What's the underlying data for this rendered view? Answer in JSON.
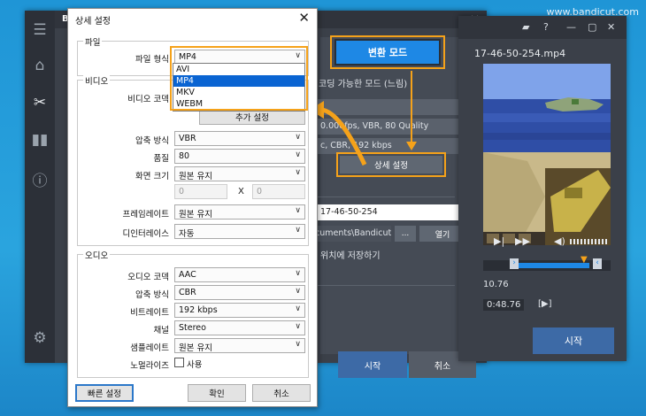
{
  "watermark": "www.bandicut.com",
  "colors": {
    "accent": "#1e88e5",
    "highlight": "#f5a21a",
    "selection": "#0a64d2"
  },
  "app": {
    "title_fragment": "B",
    "sidebar_icons": [
      "menu-icon",
      "home-icon",
      "cut-icon",
      "merge-icon",
      "info-icon",
      "settings-icon"
    ],
    "convert_mode": "변환 모드",
    "encoding_mode": "코딩 가능한 모드 (느림)",
    "video_info": "0.000fps, VBR, 80 Quality",
    "audio_info": "c, CBR, 192 kbps",
    "detail_settings": "상세 설정",
    "filename": "17-46-50-254",
    "folder": "cuments\\Bandicut",
    "browse": "...",
    "open": "열기",
    "save_same": "위치에 저장하기",
    "start": "시작",
    "cancel": "취소"
  },
  "player": {
    "file": "17-46-50-254.mp4",
    "time1": "10.76",
    "time2": "0:48.76",
    "bracket": "[▶]",
    "start": "시작",
    "progress": 0.55
  },
  "dialog": {
    "title": "상세 설정",
    "close": "✕",
    "file_group": "파일",
    "file_format_label": "파일 형식",
    "file_format": "MP4",
    "format_options": [
      "AVI",
      "MP4",
      "MKV",
      "WEBM"
    ],
    "selected_format_index": 1,
    "video_group": "비디오",
    "video_codec_label": "비디오 코덱",
    "advanced": "추가 설정",
    "compression_label": "압축 방식",
    "compression": "VBR",
    "quality_label": "품질",
    "quality": "80",
    "size_label": "화면 크기",
    "size": "원본 유지",
    "width": "0",
    "x": "X",
    "height": "0",
    "framerate_label": "프레임레이트",
    "framerate": "원본 유지",
    "deinterlace_label": "디인터레이스",
    "deinterlace": "자동",
    "audio_group": "오디오",
    "audio_codec_label": "오디오 코덱",
    "audio_codec": "AAC",
    "audio_compression_label": "압축 방식",
    "audio_compression": "CBR",
    "bitrate_label": "비트레이트",
    "bitrate": "192 kbps",
    "channel_label": "채널",
    "channel": "Stereo",
    "samplerate_label": "샘플레이트",
    "samplerate": "원본 유지",
    "normalize_label": "노멀라이즈",
    "normalize_use": "사용",
    "quick": "빠른 설정",
    "ok": "확인",
    "cancel": "취소"
  }
}
